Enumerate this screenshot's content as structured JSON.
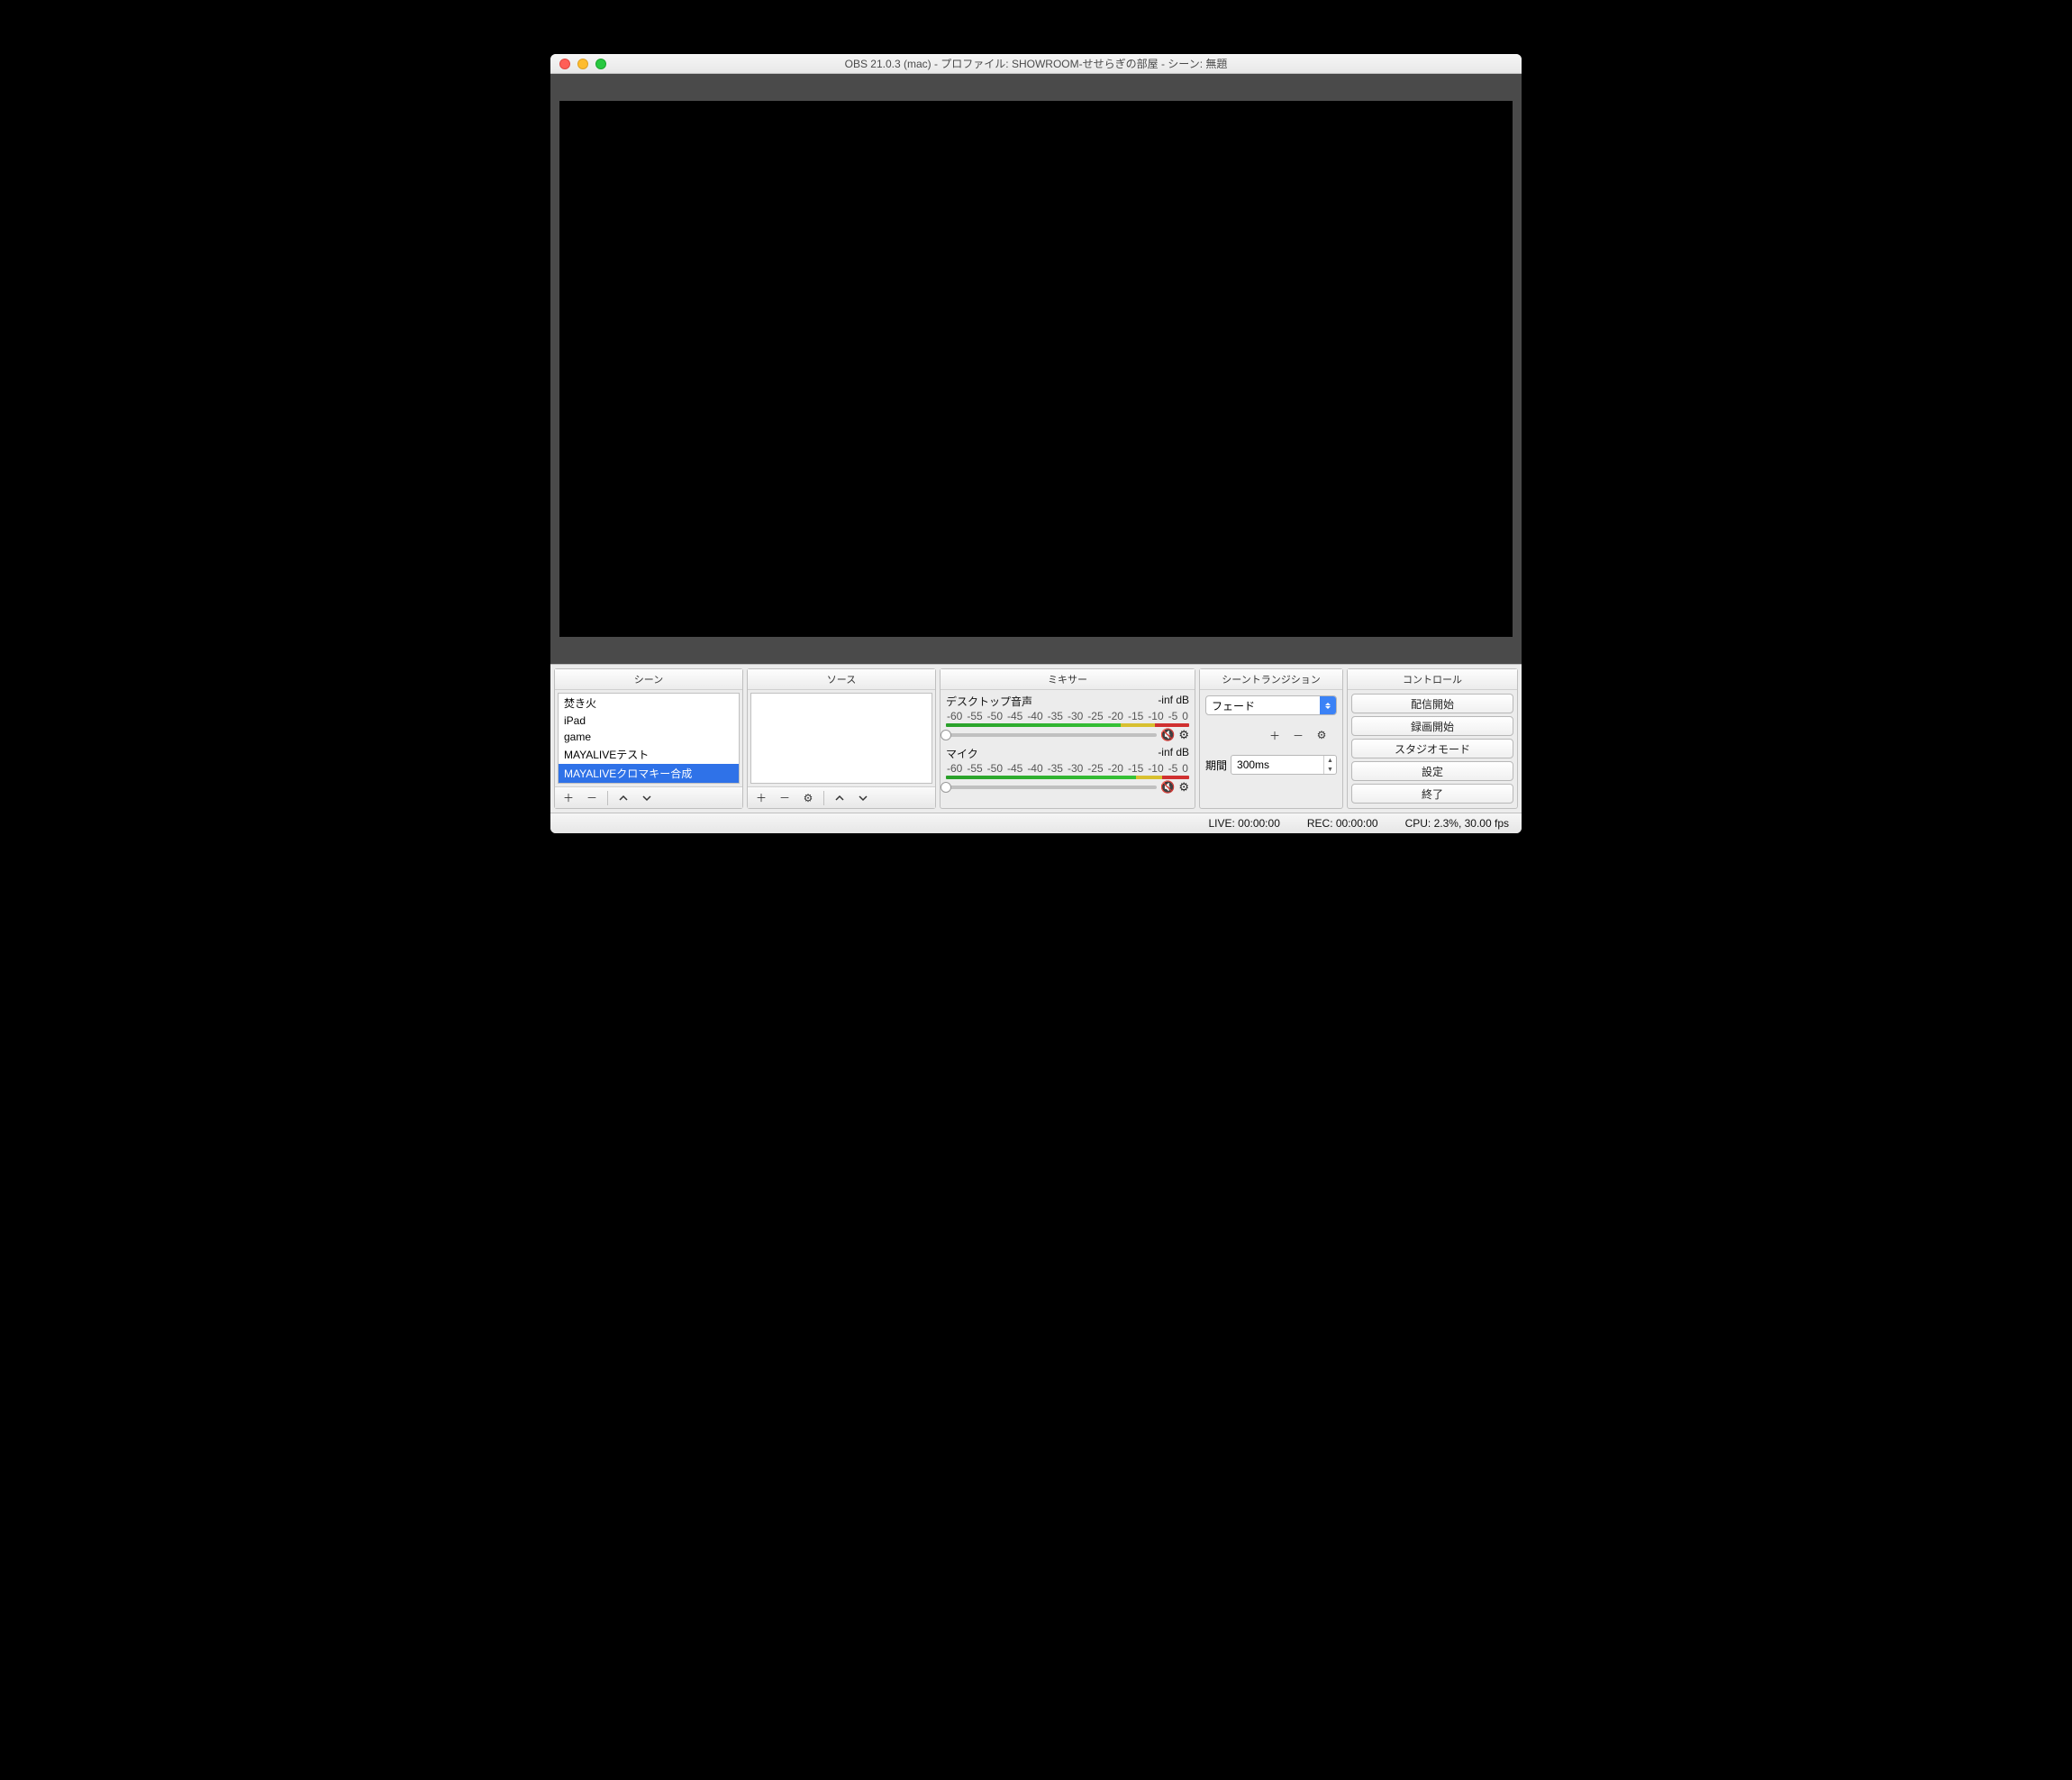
{
  "window": {
    "title": "OBS 21.0.3 (mac) - プロファイル: SHOWROOM-せせらぎの部屋 - シーン: 無題"
  },
  "docks": {
    "scenes": {
      "header": "シーン",
      "items": [
        "焚き火",
        "iPad",
        "game",
        "MAYALIVEテスト",
        "MAYALIVEクロマキー合成"
      ],
      "selected": 4
    },
    "sources": {
      "header": "ソース",
      "items": []
    },
    "mixer": {
      "header": "ミキサー",
      "ticks": [
        "-60",
        "-55",
        "-50",
        "-45",
        "-40",
        "-35",
        "-30",
        "-25",
        "-20",
        "-15",
        "-10",
        "-5",
        "0"
      ],
      "channels": [
        {
          "name": "デスクトップ音声",
          "level": "-inf dB"
        },
        {
          "name": "マイク",
          "level": "-inf dB"
        }
      ]
    },
    "transitions": {
      "header": "シーントランジション",
      "selected": "フェード",
      "duration_label": "期間",
      "duration_value": "300ms"
    },
    "controls": {
      "header": "コントロール",
      "buttons": [
        "配信開始",
        "録画開始",
        "スタジオモード",
        "設定",
        "終了"
      ]
    }
  },
  "status": {
    "live": "LIVE: 00:00:00",
    "rec": "REC: 00:00:00",
    "cpu": "CPU: 2.3%, 30.00 fps"
  }
}
